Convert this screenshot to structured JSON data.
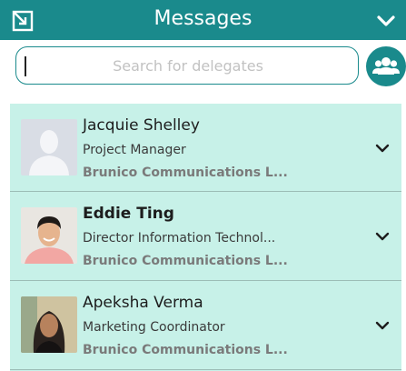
{
  "header": {
    "title": "Messages"
  },
  "search": {
    "placeholder": "Search for delegates",
    "value": ""
  },
  "delegates": [
    {
      "name": "Jacquie Shelley",
      "title": "Project Manager",
      "company": "Brunico Communications L..."
    },
    {
      "name": "Eddie Ting",
      "title": "Director Information Technol...",
      "company": "Brunico Communications L..."
    },
    {
      "name": "Apeksha Verma",
      "title": "Marketing Coordinator",
      "company": "Brunico Communications L..."
    }
  ],
  "icons": {
    "expand": "expand-icon",
    "collapse": "chevron-down-icon",
    "group": "group-icon",
    "row_expand": "chevron-down-icon"
  },
  "colors": {
    "brand": "#1a8a8c",
    "list_bg": "#c7f1e8"
  }
}
